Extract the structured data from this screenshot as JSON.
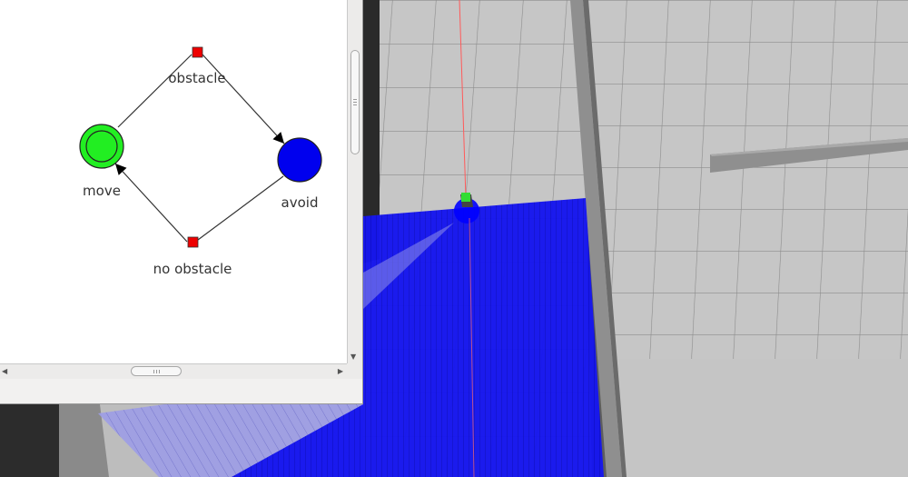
{
  "petri_net": {
    "places": [
      {
        "id": "move",
        "label": "move",
        "color": "#22ee22",
        "marked": true
      },
      {
        "id": "avoid",
        "label": "avoid",
        "color": "#0000ee",
        "marked": false
      }
    ],
    "transitions": [
      {
        "id": "obstacle",
        "label": "obstacle",
        "color": "#ee0000"
      },
      {
        "id": "no-obstacle",
        "label": "no obstacle",
        "color": "#ee0000"
      }
    ]
  },
  "scene": {
    "floor_color": "#c8c8c8",
    "grid_line_color": "#8c8c8c",
    "laser_color": "#1010f0",
    "robot_color": "#33dd33"
  }
}
